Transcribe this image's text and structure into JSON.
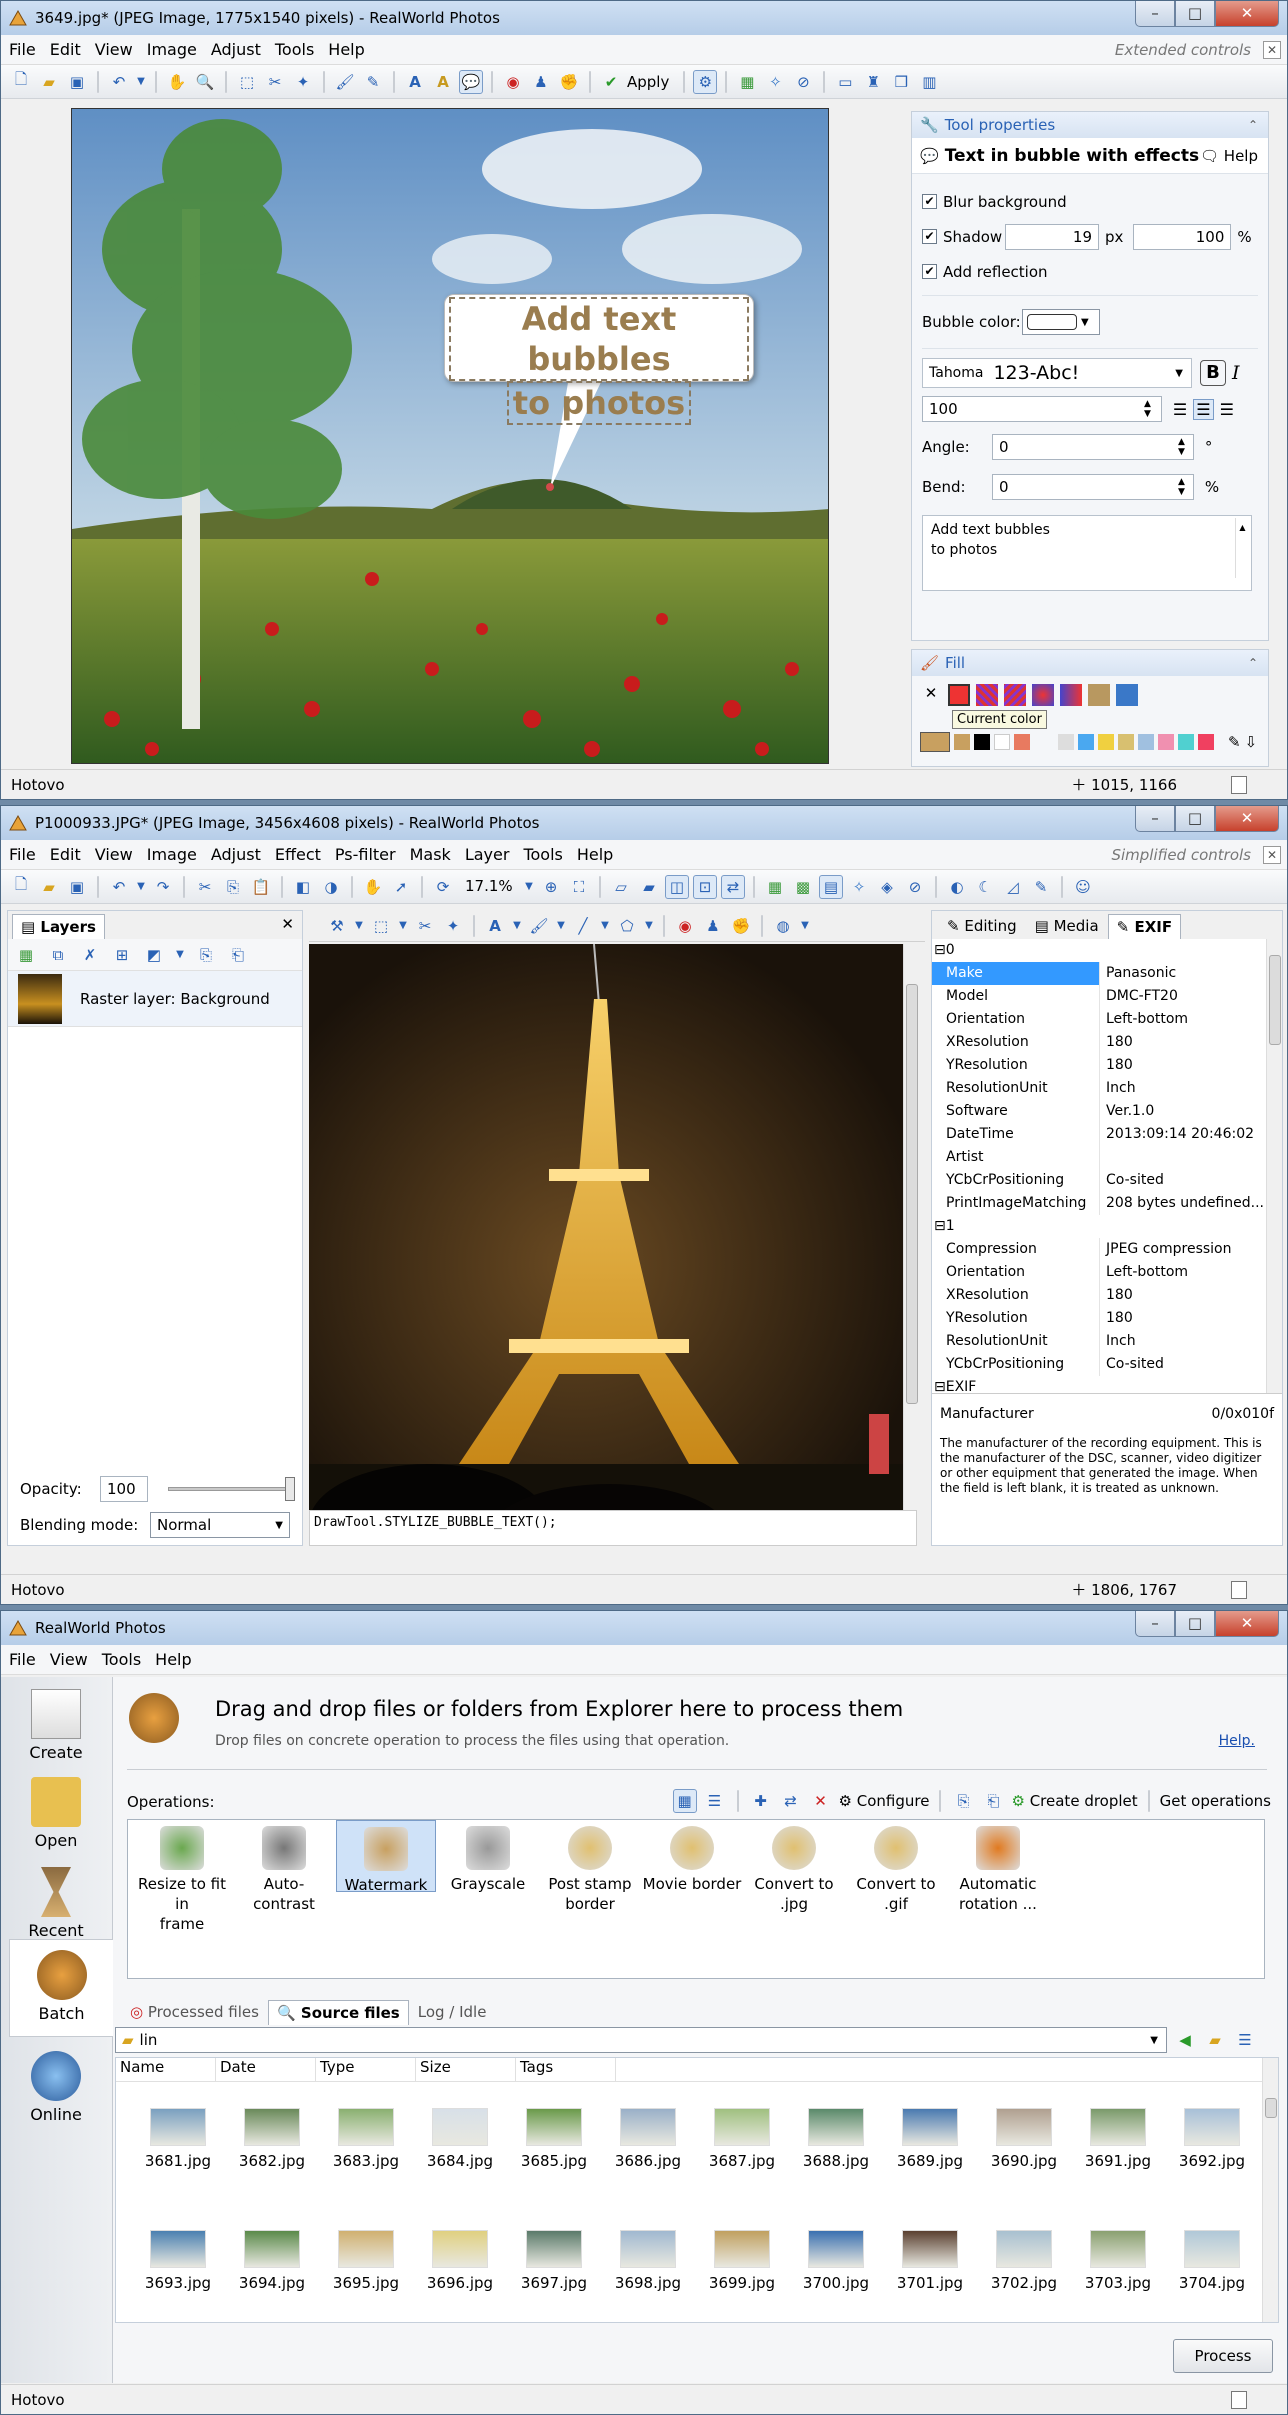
{
  "win1": {
    "title": "3649.jpg* (JPEG Image, 1775x1540 pixels) - RealWorld Photos",
    "menu": [
      "File",
      "Edit",
      "View",
      "Image",
      "Adjust",
      "Tools",
      "Help"
    ],
    "controls_mode": "Extended controls",
    "apply_label": "Apply",
    "bubble_text_line1": "Add text bubbles",
    "bubble_text_line2": "to photos",
    "tool_panel": {
      "header": "Tool properties",
      "tool_name": "Text in bubble with effects",
      "help_label": "Help",
      "blur_label": "Blur background",
      "shadow_label": "Shadow",
      "shadow_px": "19",
      "shadow_px_unit": "px",
      "shadow_pct": "100",
      "shadow_pct_unit": "%",
      "reflection_label": "Add reflection",
      "bubble_color_label": "Bubble color:",
      "font_name": "Tahoma",
      "font_preview": "123-Abc!",
      "font_size": "100",
      "angle_label": "Angle:",
      "angle_value": "0",
      "angle_unit": "°",
      "bend_label": "Bend:",
      "bend_value": "0",
      "bend_unit": "%",
      "text_line1": "Add text bubbles",
      "text_line2": "to photos"
    },
    "fill_panel": {
      "header": "Fill",
      "tooltip": "Current color"
    },
    "status_left": "Hotovo",
    "status_coords": "1015, 1166"
  },
  "win2": {
    "title": "P1000933.JPG* (JPEG Image, 3456x4608 pixels) - RealWorld Photos",
    "menu": [
      "File",
      "Edit",
      "View",
      "Image",
      "Adjust",
      "Effect",
      "Ps-filter",
      "Mask",
      "Layer",
      "Tools",
      "Help"
    ],
    "controls_mode": "Simplified controls",
    "zoom": "17.1%",
    "layers_tab": "Layers",
    "layer_name": "Raster layer: Background",
    "opacity_label": "Opacity:",
    "opacity_value": "100",
    "blending_label": "Blending mode:",
    "blending_value": "Normal",
    "script_text": "DrawTool.STYLIZE_BUBBLE_TEXT();",
    "tabs": [
      "Editing",
      "Media",
      "EXIF"
    ],
    "exif_group0": "0",
    "exif_rows0": [
      {
        "k": "Make",
        "v": "Panasonic"
      },
      {
        "k": "Model",
        "v": "DMC-FT20"
      },
      {
        "k": "Orientation",
        "v": "Left-bottom"
      },
      {
        "k": "XResolution",
        "v": "180"
      },
      {
        "k": "YResolution",
        "v": "180"
      },
      {
        "k": "ResolutionUnit",
        "v": "Inch"
      },
      {
        "k": "Software",
        "v": "Ver.1.0"
      },
      {
        "k": "DateTime",
        "v": "2013:09:14 20:46:02"
      },
      {
        "k": "Artist",
        "v": ""
      },
      {
        "k": "YCbCrPositioning",
        "v": "Co-sited"
      },
      {
        "k": "PrintImageMatching",
        "v": "208 bytes undefined..."
      }
    ],
    "exif_group1": "1",
    "exif_rows1": [
      {
        "k": "Compression",
        "v": "JPEG compression"
      },
      {
        "k": "Orientation",
        "v": "Left-bottom"
      },
      {
        "k": "XResolution",
        "v": "180"
      },
      {
        "k": "YResolution",
        "v": "180"
      },
      {
        "k": "ResolutionUnit",
        "v": "Inch"
      },
      {
        "k": "YCbCrPositioning",
        "v": "Co-sited"
      }
    ],
    "exif_group2": "EXIF",
    "desc_title": "Manufacturer",
    "desc_value": "0/0x010f",
    "desc_text": "The manufacturer of the recording equipment. This is the manufacturer of the DSC, scanner, video digitizer or other equipment that generated the image. When the field is left blank, it is treated as unknown.",
    "status_left": "Hotovo",
    "status_coords": "1806, 1767"
  },
  "win3": {
    "title": "RealWorld Photos",
    "menu": [
      "File",
      "View",
      "Tools",
      "Help"
    ],
    "sidebar": [
      "Create",
      "Open",
      "Recent",
      "Batch",
      "Online"
    ],
    "headline": "Drag and drop files or folders from Explorer here to process them",
    "subline": "Drop files on concrete operation to process the files using that operation.",
    "help_link": "Help.",
    "operations_label": "Operations:",
    "configure_label": "Configure",
    "create_droplet_label": "Create droplet",
    "get_operations_label": "Get operations",
    "operations": [
      {
        "line1": "Resize to fit in",
        "line2": "frame"
      },
      {
        "line1": "Auto-contrast",
        "line2": ""
      },
      {
        "line1": "Watermark",
        "line2": ""
      },
      {
        "line1": "Grayscale",
        "line2": ""
      },
      {
        "line1": "Post stamp",
        "line2": "border"
      },
      {
        "line1": "Movie border",
        "line2": ""
      },
      {
        "line1": "Convert to .jpg",
        "line2": ""
      },
      {
        "line1": "Convert to .gif",
        "line2": ""
      },
      {
        "line1": "Automatic",
        "line2": "rotation ..."
      }
    ],
    "file_tabs": [
      "Processed files",
      "Source files",
      "Log / Idle"
    ],
    "folder_path": "lin",
    "columns": [
      "Name",
      "Date",
      "Type",
      "Size",
      "Tags"
    ],
    "files_row1": [
      "3681.jpg",
      "3682.jpg",
      "3683.jpg",
      "3684.jpg",
      "3685.jpg",
      "3686.jpg",
      "3687.jpg",
      "3688.jpg",
      "3689.jpg",
      "3690.jpg",
      "3691.jpg",
      "3692.jpg"
    ],
    "files_row2": [
      "3693.jpg",
      "3694.jpg",
      "3695.jpg",
      "3696.jpg",
      "3697.jpg",
      "3698.jpg",
      "3699.jpg",
      "3700.jpg",
      "3701.jpg",
      "3702.jpg",
      "3703.jpg",
      "3704.jpg"
    ],
    "process_label": "Process",
    "status_left": "Hotovo"
  }
}
